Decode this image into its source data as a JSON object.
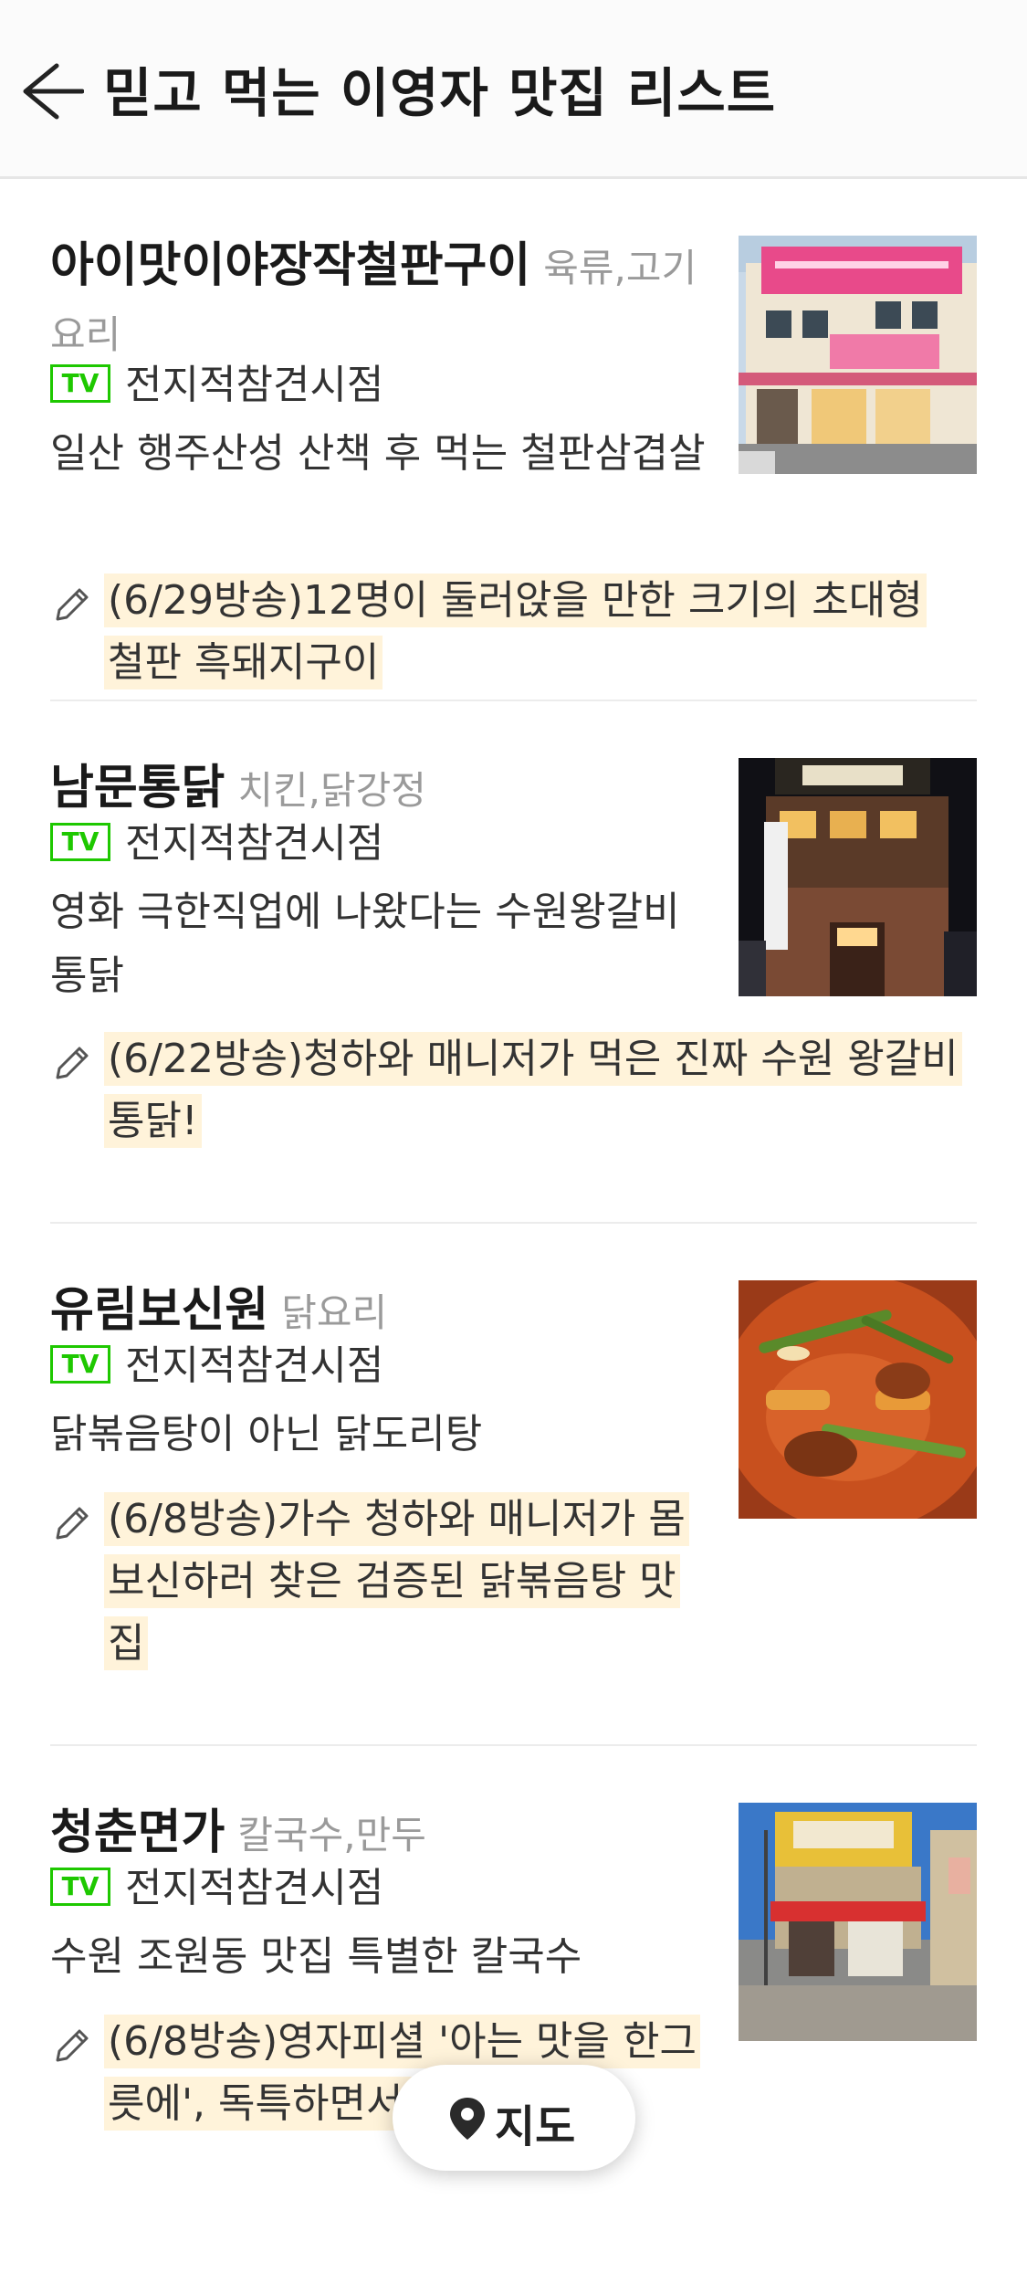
{
  "header": {
    "title": "믿고 먹는 이영자 맛집 리스트"
  },
  "restaurants": [
    {
      "name": "아이맛이야장작철판구이",
      "category": "육류,고기요리",
      "badge": "TV",
      "tv_show": "전지적참견시점",
      "description": "일산 행주산성 산책 후 먹는 철판삼겹살",
      "note": "(6/29방송)12명이 둘러앉을 만한 크기의 초대형 철판 흑돼지구이"
    },
    {
      "name": "남문통닭",
      "category": "치킨,닭강정",
      "badge": "TV",
      "tv_show": "전지적참견시점",
      "description": "영화 극한직업에 나왔다는 수원왕갈비통닭",
      "note": "(6/22방송)청하와 매니저가 먹은 진짜 수원 왕갈비통닭!"
    },
    {
      "name": "유림보신원",
      "category": "닭요리",
      "badge": "TV",
      "tv_show": "전지적참견시점",
      "description": "닭볶음탕이 아닌 닭도리탕",
      "note": "(6/8방송)가수 청하와 매니저가 몸보신하러 찾은 검증된 닭볶음탕 맛집"
    },
    {
      "name": "청춘면가",
      "category": "칼국수,만두",
      "badge": "TV",
      "tv_show": "전지적참견시점",
      "description": "수원 조원동 맛집 특별한 칼국수",
      "note": "(6/8방송)영자피셜 '아는 맛을 한그릇에', 독특하면서 착한 맛"
    }
  ],
  "map_button": {
    "label": "지도"
  },
  "colors": {
    "tv_badge": "#1ec800",
    "note_highlight": "#fff3da",
    "category": "#9a9a9a"
  }
}
